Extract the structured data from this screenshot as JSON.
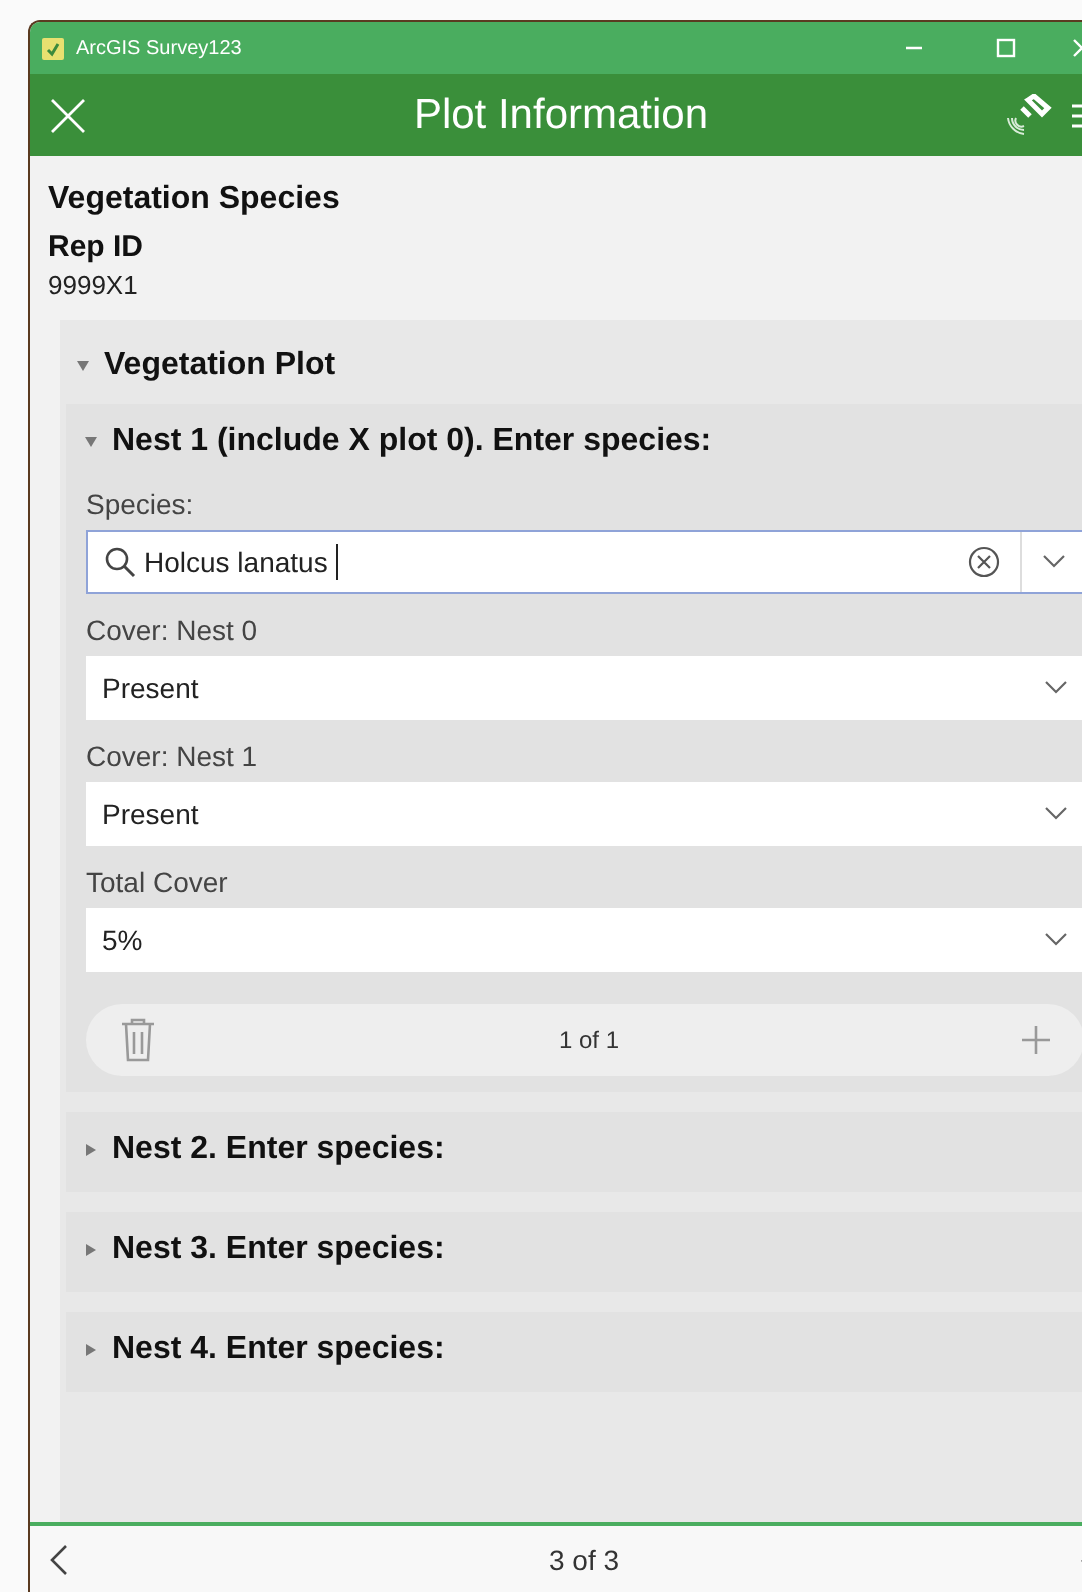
{
  "app": {
    "title": "ArcGIS Survey123"
  },
  "header": {
    "title": "Plot Information"
  },
  "form": {
    "title": "Vegetation Species",
    "rep_id": {
      "label": "Rep ID",
      "value": "9999X1"
    },
    "group": {
      "title": "Vegetation Plot",
      "expanded": true,
      "nests": [
        {
          "title": "Nest 1 (include X plot 0). Enter species:",
          "expanded": true,
          "fields": [
            {
              "kind": "search",
              "label": "Species:",
              "value": "Holcus lanatus"
            },
            {
              "kind": "select",
              "label": "Cover: Nest 0",
              "value": "Present"
            },
            {
              "kind": "select",
              "label": "Cover: Nest 1",
              "value": "Present"
            },
            {
              "kind": "select",
              "label": "Total Cover",
              "value": "5%"
            }
          ],
          "repeat": {
            "position": "1 of 1"
          }
        },
        {
          "title": "Nest 2. Enter species:",
          "expanded": false
        },
        {
          "title": "Nest 3. Enter species:",
          "expanded": false
        },
        {
          "title": "Nest 4. Enter species:",
          "expanded": false
        }
      ]
    }
  },
  "footer": {
    "page": "3 of 3"
  }
}
